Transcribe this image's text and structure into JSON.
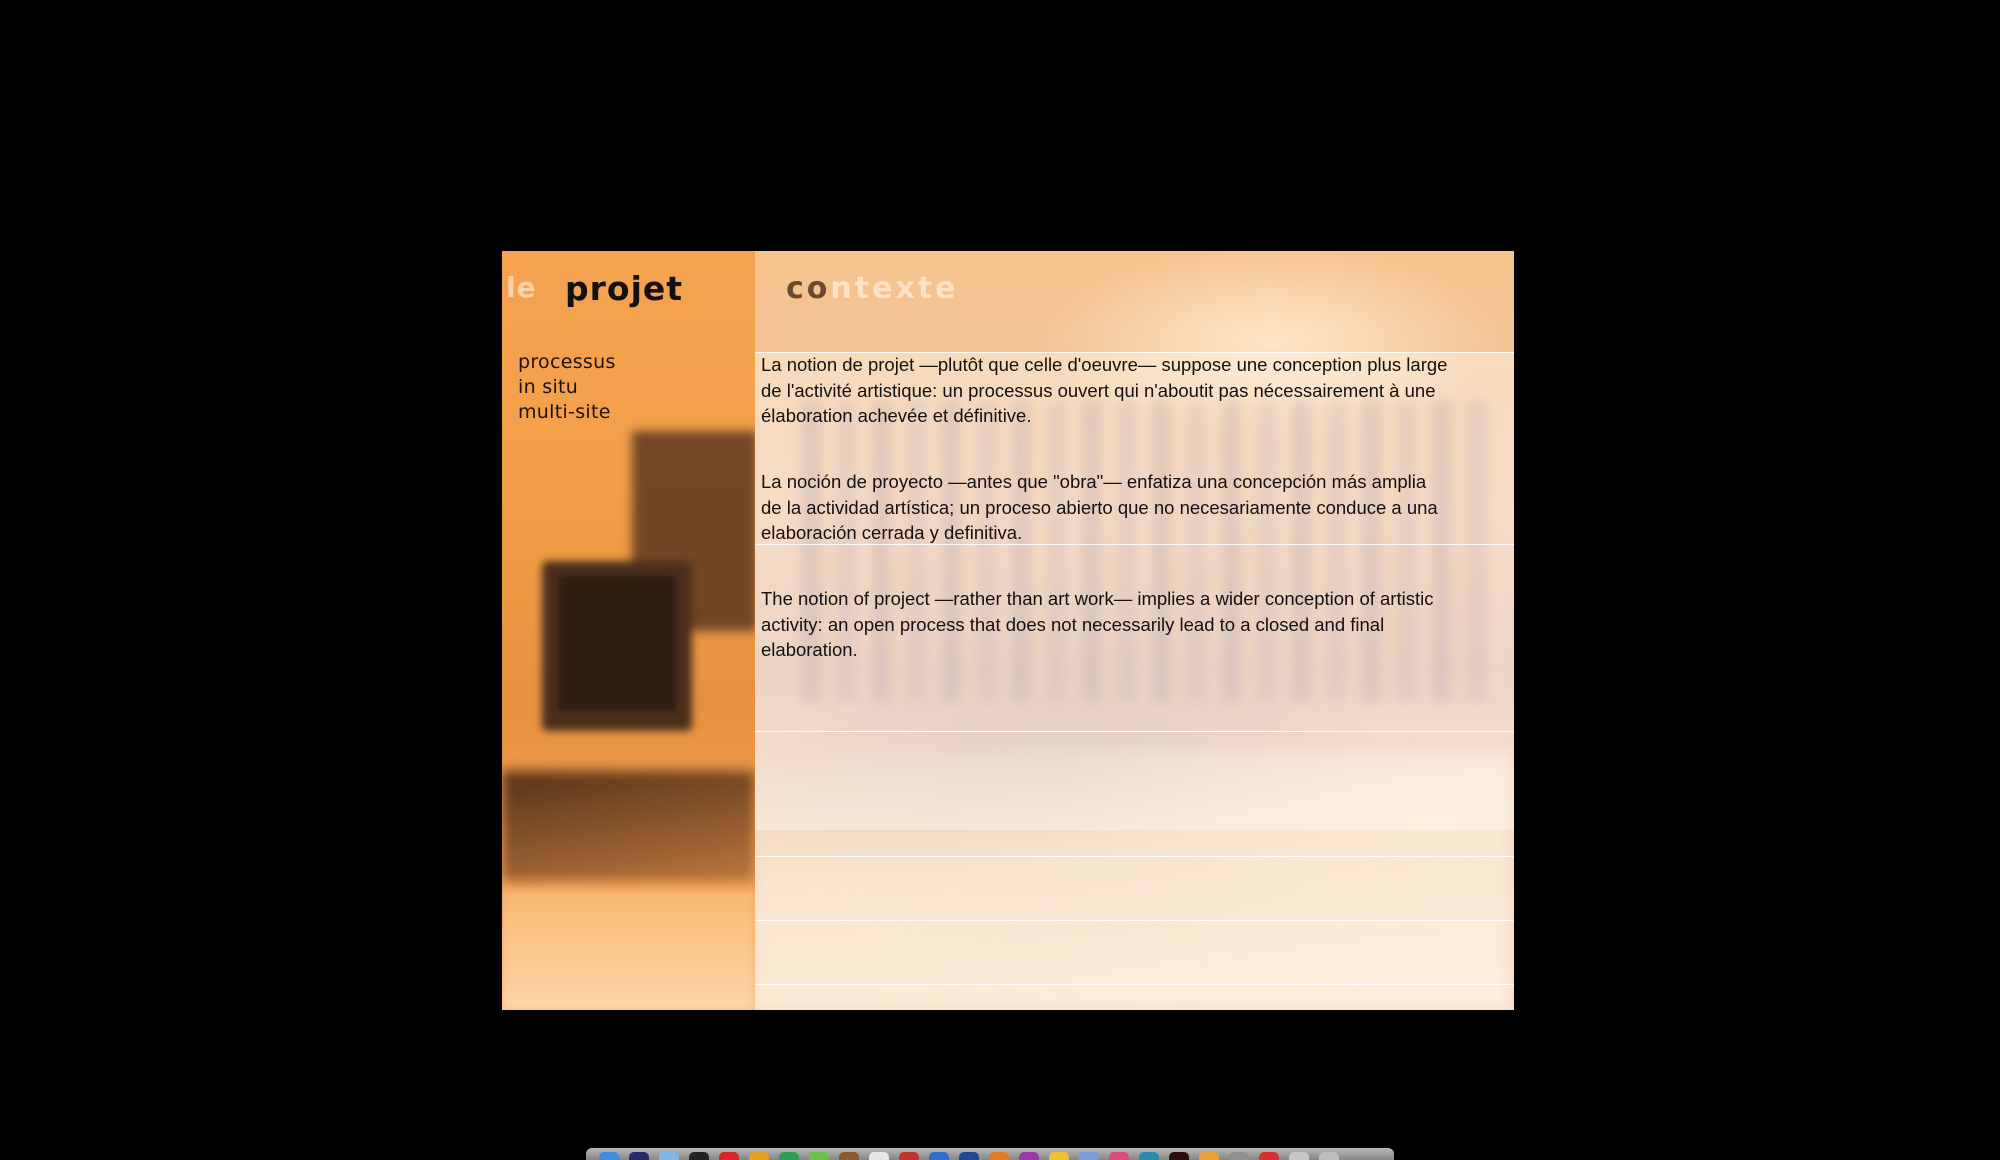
{
  "nav": {
    "prev_tab": "le",
    "current_tab": "projet",
    "next_tab_highlight": "co",
    "next_tab_rest": "ntexte"
  },
  "submenu": {
    "items": [
      "processus",
      "in situ",
      "multi-site"
    ]
  },
  "content": {
    "paragraph_fr": "La notion de projet —plutôt que celle d'oeuvre— suppose une conception plus large de l'activité artistique: un processus ouvert qui n'aboutit pas nécessairement à une élaboration achevée et définitive.",
    "paragraph_es": "La noción de proyecto —antes que \"obra\"— enfatiza una concepción más amplia de la actividad artística; un proceso abierto que no necesariamente conduce a una elaboración cerrada y definitiva.",
    "paragraph_en": "The notion of project —rather than art work— implies a wider conception of artistic activity: an open process that does not necessarily lead to a closed and final elaboration."
  },
  "colors": {
    "background": "#000000",
    "accent_orange": "#f39e48",
    "text_dark": "#111111"
  },
  "dock": {
    "icons": [
      {
        "name": "finder-icon",
        "color": "#3d8de0"
      },
      {
        "name": "dashboard-icon",
        "color": "#2a2a6a"
      },
      {
        "name": "safari-icon",
        "color": "#7fb6e8"
      },
      {
        "name": "terminal-icon",
        "color": "#222222"
      },
      {
        "name": "app-red-icon",
        "color": "#d8262a"
      },
      {
        "name": "app-multicolor-icon",
        "color": "#e8a020"
      },
      {
        "name": "app-green-icon",
        "color": "#2f9e5a"
      },
      {
        "name": "app-lime-icon",
        "color": "#6cc24a"
      },
      {
        "name": "app-brown-icon",
        "color": "#8a5a2a"
      },
      {
        "name": "app-white-icon",
        "color": "#e6e6e6"
      },
      {
        "name": "app-redstripe-icon",
        "color": "#c83030"
      },
      {
        "name": "app-blue-icon",
        "color": "#2e6fd0"
      },
      {
        "name": "app-navy-icon",
        "color": "#1e4a9a"
      },
      {
        "name": "app-orange-icon",
        "color": "#e67a20"
      },
      {
        "name": "app-purple-icon",
        "color": "#9a3aa8"
      },
      {
        "name": "app-yellow-icon",
        "color": "#f0c030"
      },
      {
        "name": "app-folder-icon",
        "color": "#7a9ed8"
      },
      {
        "name": "app-pink-icon",
        "color": "#e04a7a"
      },
      {
        "name": "app-teal-icon",
        "color": "#2a8ab0"
      },
      {
        "name": "app-black-icon",
        "color": "#2a0e0e"
      },
      {
        "name": "app-amber-icon",
        "color": "#f0a030"
      },
      {
        "name": "app-gray-icon",
        "color": "#909090"
      },
      {
        "name": "app-badge-icon",
        "color": "#d83030"
      },
      {
        "name": "app-silver-icon",
        "color": "#c8c8c8"
      },
      {
        "name": "trash-icon",
        "color": "#bdbdbd"
      }
    ]
  }
}
